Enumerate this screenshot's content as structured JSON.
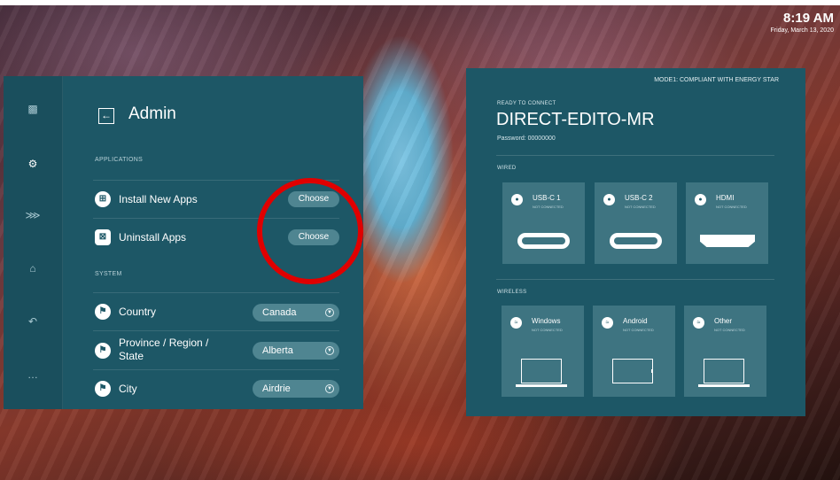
{
  "clock": {
    "time": "8:19 AM",
    "date": "Friday, March 13, 2020"
  },
  "admin": {
    "title": "Admin",
    "back_icon": "back-arrow-icon",
    "rail_icons": [
      "exit-icon",
      "gear-icon",
      "share-icon",
      "home-icon",
      "undo-icon",
      "more-icon"
    ],
    "applications_label": "APPLICATIONS",
    "install_label": "Install New Apps",
    "install_button": "Choose",
    "uninstall_label": "Uninstall Apps",
    "uninstall_button": "Choose",
    "system_label": "SYSTEM",
    "country_label": "Country",
    "country_value": "Canada",
    "province_label_line1": "Province / Region /",
    "province_label_line2": "State",
    "province_value": "Alberta",
    "city_label": "City",
    "city_value": "Airdrie"
  },
  "connect": {
    "mode": "MODE1: COMPLIANT WITH ENERGY STAR",
    "ready_label": "READY TO CONNECT",
    "device_name": "DIRECT-EDITO-MR",
    "password": "Password: 00000000",
    "wired_label": "WIRED",
    "wired": [
      {
        "title": "USB-C 1",
        "sub": "NOT CONNECTED",
        "icon": "usb-icon"
      },
      {
        "title": "USB-C 2",
        "sub": "NOT CONNECTED",
        "icon": "usb-icon"
      },
      {
        "title": "HDMI",
        "sub": "NOT CONNECTED",
        "icon": "hdmi-icon"
      }
    ],
    "wireless_label": "WIRELESS",
    "wireless": [
      {
        "title": "Windows",
        "sub": "NOT CONNECTED",
        "icon": "wifi-icon"
      },
      {
        "title": "Android",
        "sub": "NOT CONNECTED",
        "icon": "wifi-icon"
      },
      {
        "title": "Other",
        "sub": "NOT CONNECTED",
        "icon": "wifi-icon"
      }
    ]
  },
  "colors": {
    "panel": "#1d5766",
    "card": "#3e7481",
    "button": "#4f8591",
    "highlight": "#e00000"
  }
}
